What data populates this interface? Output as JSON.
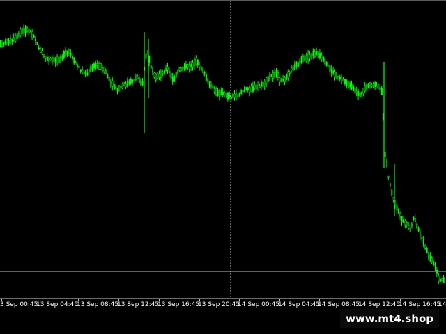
{
  "watermark": "www.mt4.shop",
  "colors": {
    "background": "#000000",
    "candle": "#00ff00",
    "grid_vertical": "#c0c0c0",
    "hline": "#c0c0c0",
    "text": "#ffffff"
  },
  "time_axis": {
    "labels": [
      "3 Sep 00:45",
      "13 Sep 04:45",
      "13 Sep 08:45",
      "13 Sep 12:45",
      "13 Sep 16:45",
      "13 Sep 20:45",
      "14 Sep 00:45",
      "14 Sep 04:45",
      "14 Sep 08:45",
      "14 Sep 12:45",
      "14 Sep 16:45",
      "14"
    ]
  },
  "chart_data": {
    "type": "candlestick",
    "title": "",
    "xlabel": "",
    "ylabel": "",
    "grid": false,
    "price_scale_visible": false,
    "period_separator": "14 Sep 00:45",
    "series": [
      {
        "name": "",
        "close_path_levels": [
          60,
          62,
          58,
          55,
          50,
          45,
          42,
          48,
          55,
          70,
          82,
          85,
          84,
          82,
          80,
          78,
          70,
          68,
          80,
          90,
          95,
          100,
          105,
          110,
          115,
          120,
          122,
          124,
          125,
          118,
          115,
          112,
          110,
          108,
          105,
          100,
          95,
          90,
          100,
          110,
          115,
          120,
          122,
          125,
          118,
          112,
          105,
          100,
          95,
          90,
          95,
          100,
          105,
          110,
          115,
          120,
          125,
          130,
          132,
          133,
          134,
          135,
          136,
          132,
          130,
          128,
          128,
          127,
          126,
          125,
          124,
          123,
          120,
          112,
          105,
          100,
          95,
          92,
          90,
          85,
          80,
          75,
          78,
          82,
          88,
          95,
          105,
          112,
          115,
          118,
          120,
          125,
          130,
          135,
          138,
          140,
          135,
          130,
          128,
          125,
          230,
          260,
          280,
          300,
          310,
          320,
          330,
          335,
          340,
          345,
          350,
          355,
          360,
          365,
          370,
          378,
          390,
          400,
          405,
          408
        ],
        "note_levels_are_screen_relative": false
      }
    ]
  }
}
